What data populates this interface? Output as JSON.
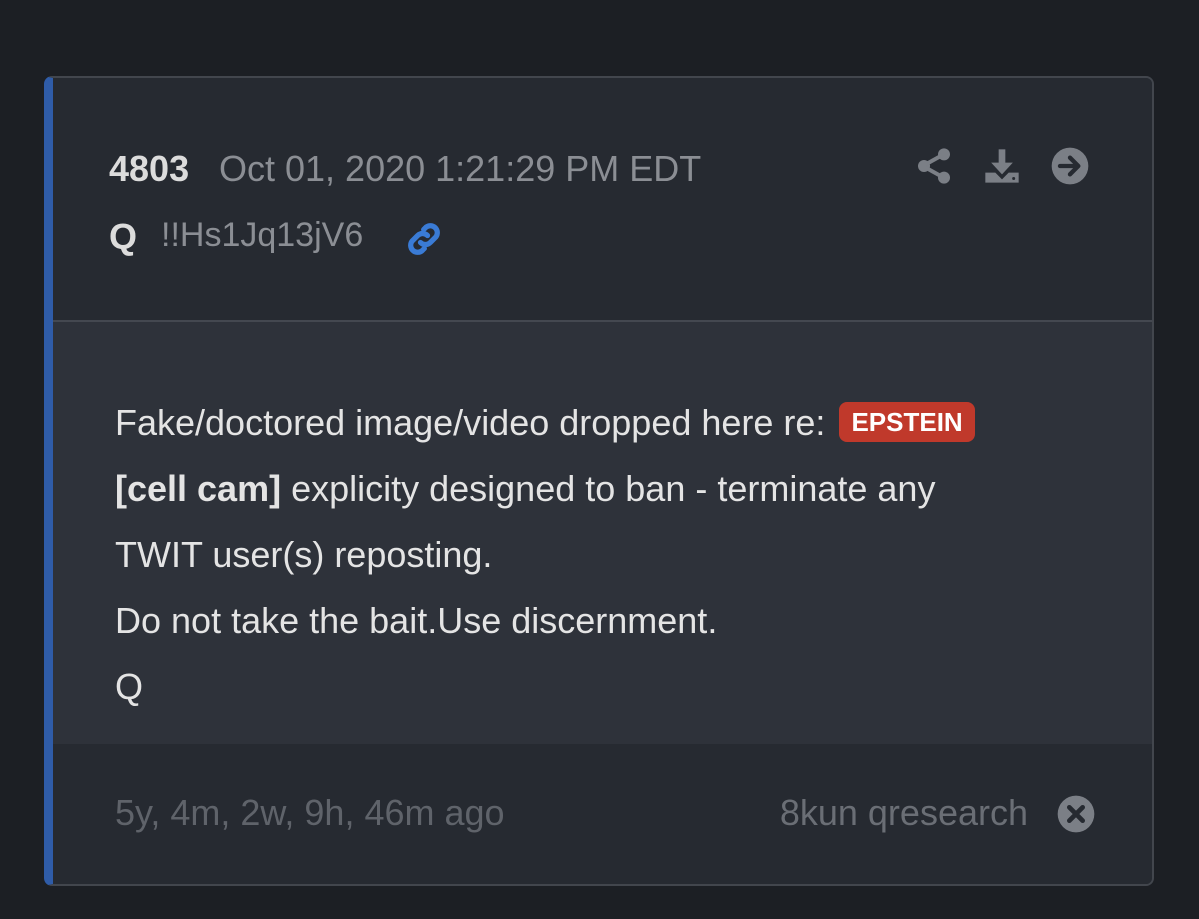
{
  "post": {
    "number": "4803",
    "date": "Oct 01, 2020 1:21:29 PM EDT",
    "author": "Q",
    "tripcode": "!!Hs1Jq13jV6"
  },
  "header_actions": [
    {
      "icon": "share-icon"
    },
    {
      "icon": "download-icon"
    },
    {
      "icon": "arrow-right-circle-icon"
    }
  ],
  "message": {
    "line1_text": "Fake/doctored image/video dropped here re:",
    "tag": "EPSTEIN",
    "line2_bold": "[cell cam]",
    "line2_text": " explicity designed to ban - terminate any",
    "line3": "TWIT user(s) reposting.",
    "line4": "Do not take the bait.Use discernment.",
    "line5": "Q"
  },
  "footer": {
    "time_ago": "5y, 4m, 2w, 9h, 46m ago",
    "source": "8kun qresearch"
  },
  "colors": {
    "accent": "#2f5ca8",
    "tag": "#c0392b",
    "link": "#3a7bd5"
  }
}
